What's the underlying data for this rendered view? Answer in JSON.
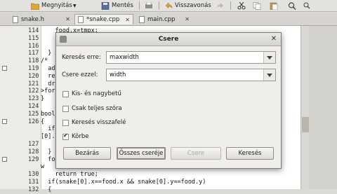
{
  "toolbar": {
    "open_label": "Megnyitás",
    "save_label": "Mentés",
    "undo_label": "Visszavonás"
  },
  "tabs": [
    {
      "label": "snake.h"
    },
    {
      "label": "*snake.cpp"
    },
    {
      "label": "main.cpp"
    }
  ],
  "editor": {
    "lines": [
      {
        "num": "114",
        "text": "    food.x=tmpx;"
      },
      {
        "num": "115",
        "text": ""
      },
      {
        "num": "116",
        "text": ""
      },
      {
        "num": "117",
        "text": "  }"
      },
      {
        "num": "118",
        "text": "/*"
      },
      {
        "num": "119",
        "text": "  ad"
      },
      {
        "num": "120",
        "text": "  re"
      },
      {
        "num": "121",
        "text": "  dra"
      },
      {
        "num": "122",
        "text": ">for"
      },
      {
        "num": "123",
        "text": "}"
      },
      {
        "num": "124",
        "text": ""
      },
      {
        "num": "125",
        "text": "bool"
      },
      {
        "num": "126",
        "text": "{"
      },
      {
        "num": "",
        "text": "  if"
      },
      {
        "num": "",
        "text": "[0]."
      },
      {
        "num": "127",
        "text": ""
      },
      {
        "num": "128",
        "text": "  }"
      },
      {
        "num": "129",
        "text": "  fo"
      },
      {
        "num": "",
        "text": "w"
      },
      {
        "num": "130",
        "text": "    return true;"
      },
      {
        "num": "131",
        "text": "  if(snake[0].x==food.x && snake[0].y==food.y)"
      },
      {
        "num": "132",
        "text": "  {"
      }
    ]
  },
  "dialog": {
    "title": "Csere",
    "search_label": "Keresés erre:",
    "search_value": "maxwidth",
    "replace_label": "Csere ezzel:",
    "replace_value": "width",
    "options": [
      {
        "label": "Kis- és nagybetű",
        "checked": false
      },
      {
        "label": "Csak teljes szóra",
        "checked": false
      },
      {
        "label": "Keresés visszafelé",
        "checked": false
      },
      {
        "label": "Körbe",
        "checked": true
      }
    ],
    "buttons": {
      "close": "Bezárás",
      "replace_all": "Összes cseréje",
      "replace": "Csere",
      "find": "Keresés"
    }
  }
}
